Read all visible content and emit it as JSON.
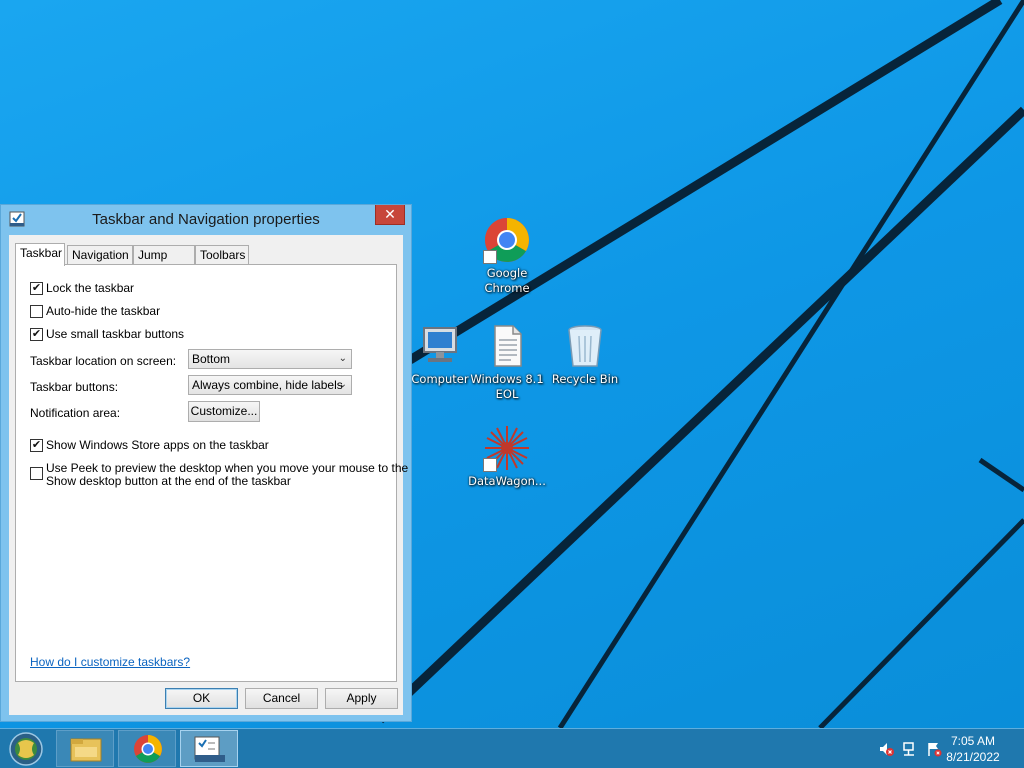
{
  "desktop": {
    "icons": [
      {
        "label": "Google Chrome",
        "icon": "chrome-icon",
        "shortcut": true
      },
      {
        "label": "Computer",
        "icon": "computer-icon",
        "shortcut": false
      },
      {
        "label": "Windows 8.1 EOL",
        "icon": "text-file-icon",
        "shortcut": false
      },
      {
        "label": "Recycle Bin",
        "icon": "recycle-bin-icon",
        "shortcut": false
      },
      {
        "label": "DataWagon...",
        "icon": "datawagon-icon",
        "shortcut": true
      }
    ]
  },
  "dialog": {
    "title": "Taskbar and Navigation properties",
    "close_label": "✕",
    "tabs": [
      {
        "label": "Taskbar",
        "active": true
      },
      {
        "label": "Navigation",
        "active": false
      },
      {
        "label": "Jump Lists",
        "active": false
      },
      {
        "label": "Toolbars",
        "active": false
      }
    ],
    "checkboxes": [
      {
        "label": "Lock the taskbar",
        "checked": true
      },
      {
        "label": "Auto-hide the taskbar",
        "checked": false
      },
      {
        "label": "Use small taskbar buttons",
        "checked": true
      }
    ],
    "location_label": "Taskbar location on screen:",
    "location_value": "Bottom",
    "buttons_label": "Taskbar buttons:",
    "buttons_value": "Always combine, hide labels",
    "notification_label": "Notification area:",
    "customize_label": "Customize...",
    "store_apps": {
      "label": "Show Windows Store apps on the taskbar",
      "checked": true
    },
    "peek": {
      "label_line1": "Use Peek to preview the desktop when you move your mouse to the",
      "label_line2": "Show desktop button at the end of the taskbar",
      "checked": false
    },
    "help_link": "How do I customize taskbars?",
    "ok_label": "OK",
    "cancel_label": "Cancel",
    "apply_label": "Apply"
  },
  "taskbar": {
    "apps": [
      "file-explorer-icon",
      "chrome-icon",
      "taskbar-properties-icon"
    ],
    "clock_time": "7:05 AM",
    "clock_date": "8/21/2022"
  },
  "colors": {
    "desktop_bg": "#0e99e8",
    "taskbar_bg": "#1f78ae",
    "close_red": "#c7463a",
    "link_blue": "#0b64c0"
  }
}
